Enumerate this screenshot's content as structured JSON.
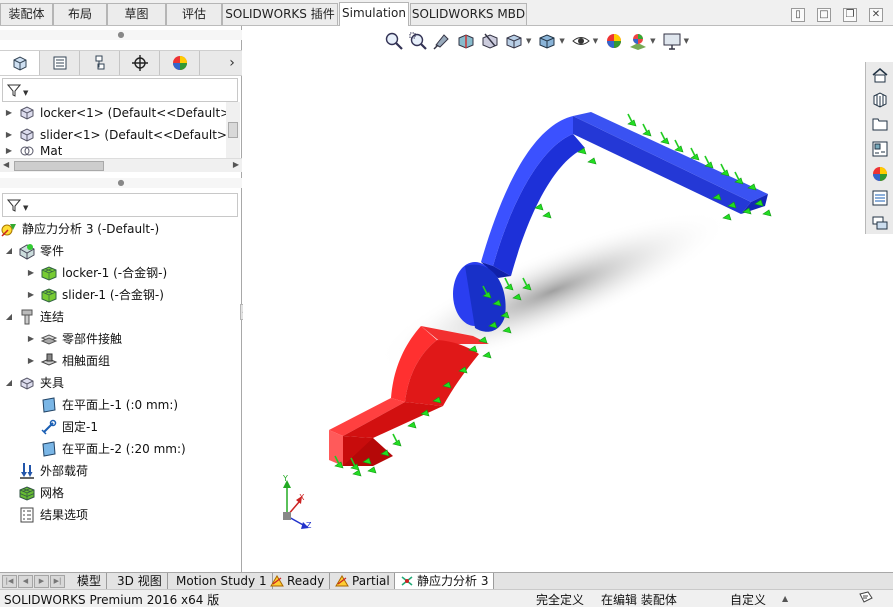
{
  "command_tabs": [
    "装配体",
    "布局",
    "草图",
    "评估",
    "SOLIDWORKS 插件",
    "Simulation",
    "SOLIDWORKS MBD"
  ],
  "active_command_tab": "Simulation",
  "feature_tree": {
    "items": [
      {
        "label": "locker<1> (Default<<Default>"
      },
      {
        "label": "slider<1> (Default<<Default>_"
      },
      {
        "label": "Mat"
      }
    ]
  },
  "sim_tree": {
    "study": "静应力分析 3 (-Default-)",
    "parts": "零件",
    "part_items": [
      "locker-1 (-合金钢-)",
      "slider-1 (-合金钢-)"
    ],
    "connections": "连结",
    "connection_items": [
      "零部件接触",
      "相触面组"
    ],
    "fixtures": "夹具",
    "fixture_items": [
      "在平面上-1 (:0 mm:)",
      "固定-1",
      "在平面上-2 (:20 mm:)"
    ],
    "loads": "外部载荷",
    "mesh": "网格",
    "results": "结果选项"
  },
  "triad": {
    "x": "X",
    "y": "Y",
    "z": "Z"
  },
  "bottom_tabs": [
    "模型",
    "3D 视图",
    "Motion Study 1",
    "Ready",
    "Partial",
    "静应力分析 3"
  ],
  "active_bottom_tab": "静应力分析 3",
  "status": {
    "product": "SOLIDWORKS Premium 2016 x64 版",
    "definition": "完全定义",
    "editing": "在编辑 装配体",
    "custom": "自定义"
  },
  "colors": {
    "blue_part": "#1530e8",
    "red_part": "#ee1111",
    "load_arrows": "#22dd22"
  }
}
